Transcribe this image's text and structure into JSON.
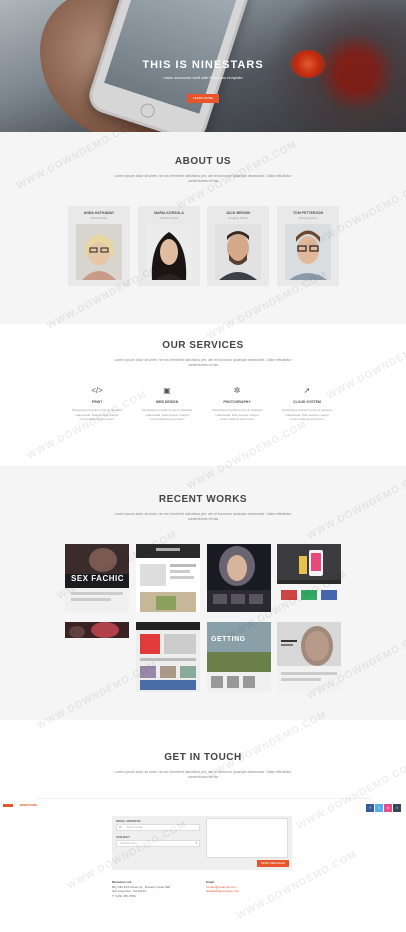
{
  "hero": {
    "title": "THIS IS NINESTARS",
    "subtitle": "make awesome stuff with Ninestars template",
    "button": "LEARN MORE"
  },
  "about": {
    "title": "ABOUT US",
    "desc": "Lorem ipsum dolor sit amet, ne nec hendrerit rationibus per, vim et bonorum quaeque deseruisse. Ullam efficiantur contentiones et has",
    "team": [
      {
        "name": "ANNA HATHAWAY",
        "role": "Photo Editor"
      },
      {
        "name": "MARIA KORSOLA",
        "role": "Product Styler"
      },
      {
        "name": "JACK BROWN",
        "role": "Creative Writer"
      },
      {
        "name": "TOM PETTERSON",
        "role": "Photographer"
      }
    ]
  },
  "services": {
    "title": "OUR SERVICES",
    "desc": "Lorem ipsum dolor sit amet, ne nec hendrerit rationibus per, vim et bonorum quaeque deseruisse. Ullam efficiantur contentiones et has",
    "items": [
      {
        "icon": "code-icon",
        "glyph": "</>",
        "title": "PRINT",
        "text": "Scelerisque tincidunt enim in pharetra malesuada. Duis semper magna metus eleifend accumsan."
      },
      {
        "icon": "briefcase-icon",
        "glyph": "▣",
        "title": "WEB DESIGN",
        "text": "Scelerisque tincidunt enim in pharetra malesuada. Duis semper magna metus eleifend accumsan."
      },
      {
        "icon": "gear-icon",
        "glyph": "✲",
        "title": "PHOTOGRAPHY",
        "text": "Scelerisque tincidunt enim in pharetra malesuada. Duis semper magna metus eleifend accumsan."
      },
      {
        "icon": "rocket-icon",
        "glyph": "➚",
        "title": "CLOUD SYSTEM",
        "text": "Scelerisque tincidunt enim in pharetra malesuada. Duis semper magna metus eleifend accumsan."
      }
    ]
  },
  "works": {
    "title": "RECENT WORKS",
    "desc": "Lorem ipsum dolor sit amet, ne nec hendrerit rationibus per, vim et bonorum quaeque deseruisse. Ullam efficiantur contentiones et has",
    "thumb_labels": [
      "SEX FACHIC",
      "GETTING"
    ]
  },
  "contact": {
    "title": "GET IN TOUCH",
    "desc": "Lorem ipsum dolor sit amet, ne nec hendrerit rationibus per, vim et bonorum quaeque deseruisse. Ullam efficiantur contentiones et has",
    "brand": "NINESTARS",
    "email_label": "EMAIL ADDRESS",
    "email_placeholder": "Enter email",
    "subject_label": "SUBJECT",
    "subject_value": "Choose One",
    "send": "SEND MESSAGE",
    "addr_title": "Ninestars Ltd.",
    "addr_lines": [
      "Big Villa 334 Ocean str., Brooklyn Suite 998",
      "San Francisco, CA 94720",
      "T: (123) 456-7890"
    ],
    "email_title": "Email",
    "emails": [
      "contact@example.com",
      "feedback@example.com"
    ]
  },
  "social": [
    {
      "icon": "facebook-icon",
      "glyph": "f",
      "color": "#3b5998"
    },
    {
      "icon": "twitter-icon",
      "glyph": "t",
      "color": "#55acee"
    },
    {
      "icon": "dribbble-icon",
      "glyph": "d",
      "color": "#ea4c89"
    },
    {
      "icon": "tumblr-icon",
      "glyph": "t",
      "color": "#35465c"
    }
  ],
  "colors": {
    "accent": "#e8552a"
  },
  "watermark": "WWW.DOWNDEMO.COM"
}
